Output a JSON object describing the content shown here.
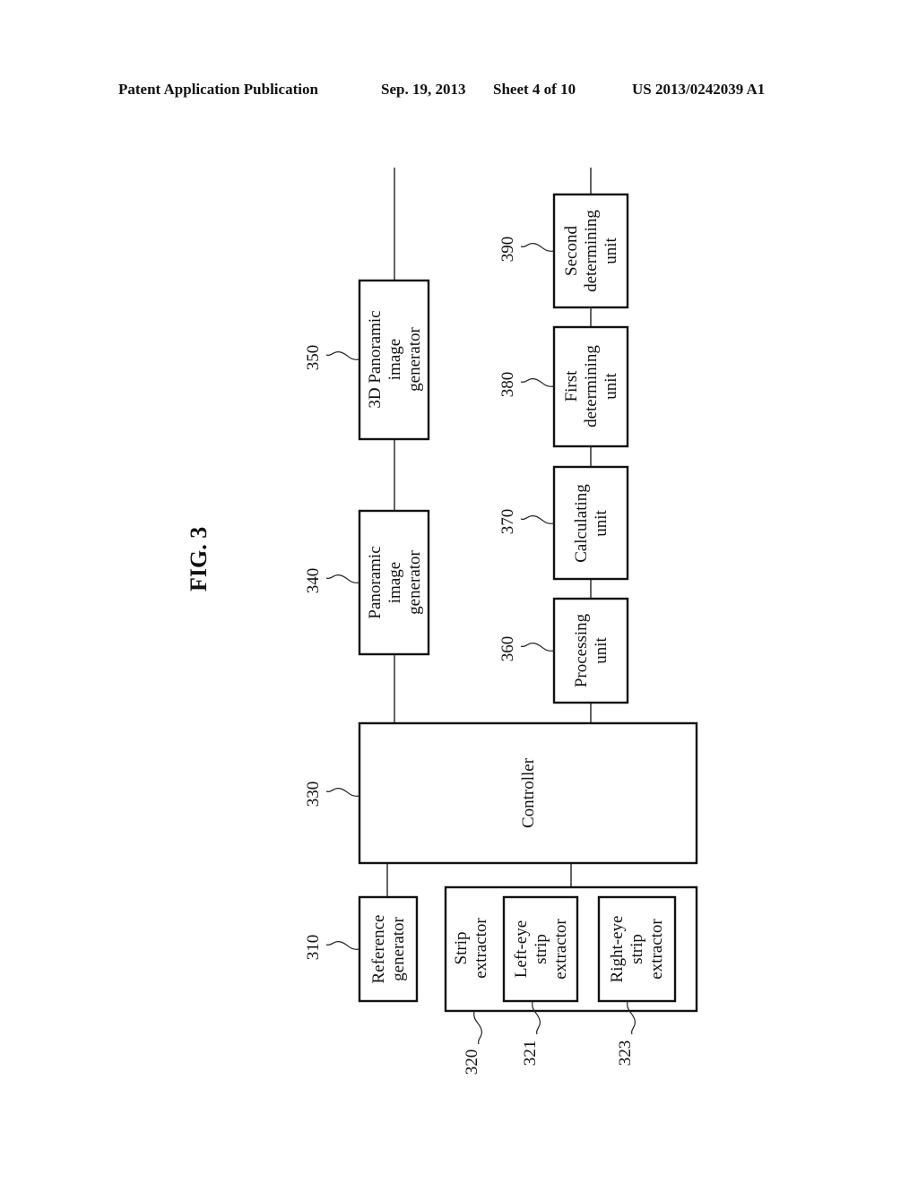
{
  "header": {
    "publication": "Patent Application Publication",
    "date": "Sep. 19, 2013",
    "sheet": "Sheet 4 of 10",
    "number": "US 2013/0242039 A1"
  },
  "figure": {
    "title": "FIG. 3"
  },
  "blocks": {
    "b310": {
      "ref": "310",
      "lines": [
        "Reference",
        "generator"
      ]
    },
    "b320": {
      "ref": "320",
      "lines": [
        "Strip",
        "extractor"
      ]
    },
    "b321": {
      "ref": "321",
      "lines": [
        "Left-eye",
        "strip",
        "extractor"
      ]
    },
    "b323": {
      "ref": "323",
      "lines": [
        "Right-eye",
        "strip",
        "extractor"
      ]
    },
    "b330": {
      "ref": "330",
      "lines": [
        "Controller"
      ]
    },
    "b340": {
      "ref": "340",
      "lines": [
        "Panoramic",
        "image",
        "generator"
      ]
    },
    "b350": {
      "ref": "350",
      "lines": [
        "3D Panoramic",
        "image",
        "generator"
      ]
    },
    "b360": {
      "ref": "360",
      "lines": [
        "Processing",
        "unit"
      ]
    },
    "b370": {
      "ref": "370",
      "lines": [
        "Calculating",
        "unit"
      ]
    },
    "b380": {
      "ref": "380",
      "lines": [
        "First",
        "determining",
        "unit"
      ]
    },
    "b390": {
      "ref": "390",
      "lines": [
        "Second",
        "determining",
        "unit"
      ]
    }
  }
}
